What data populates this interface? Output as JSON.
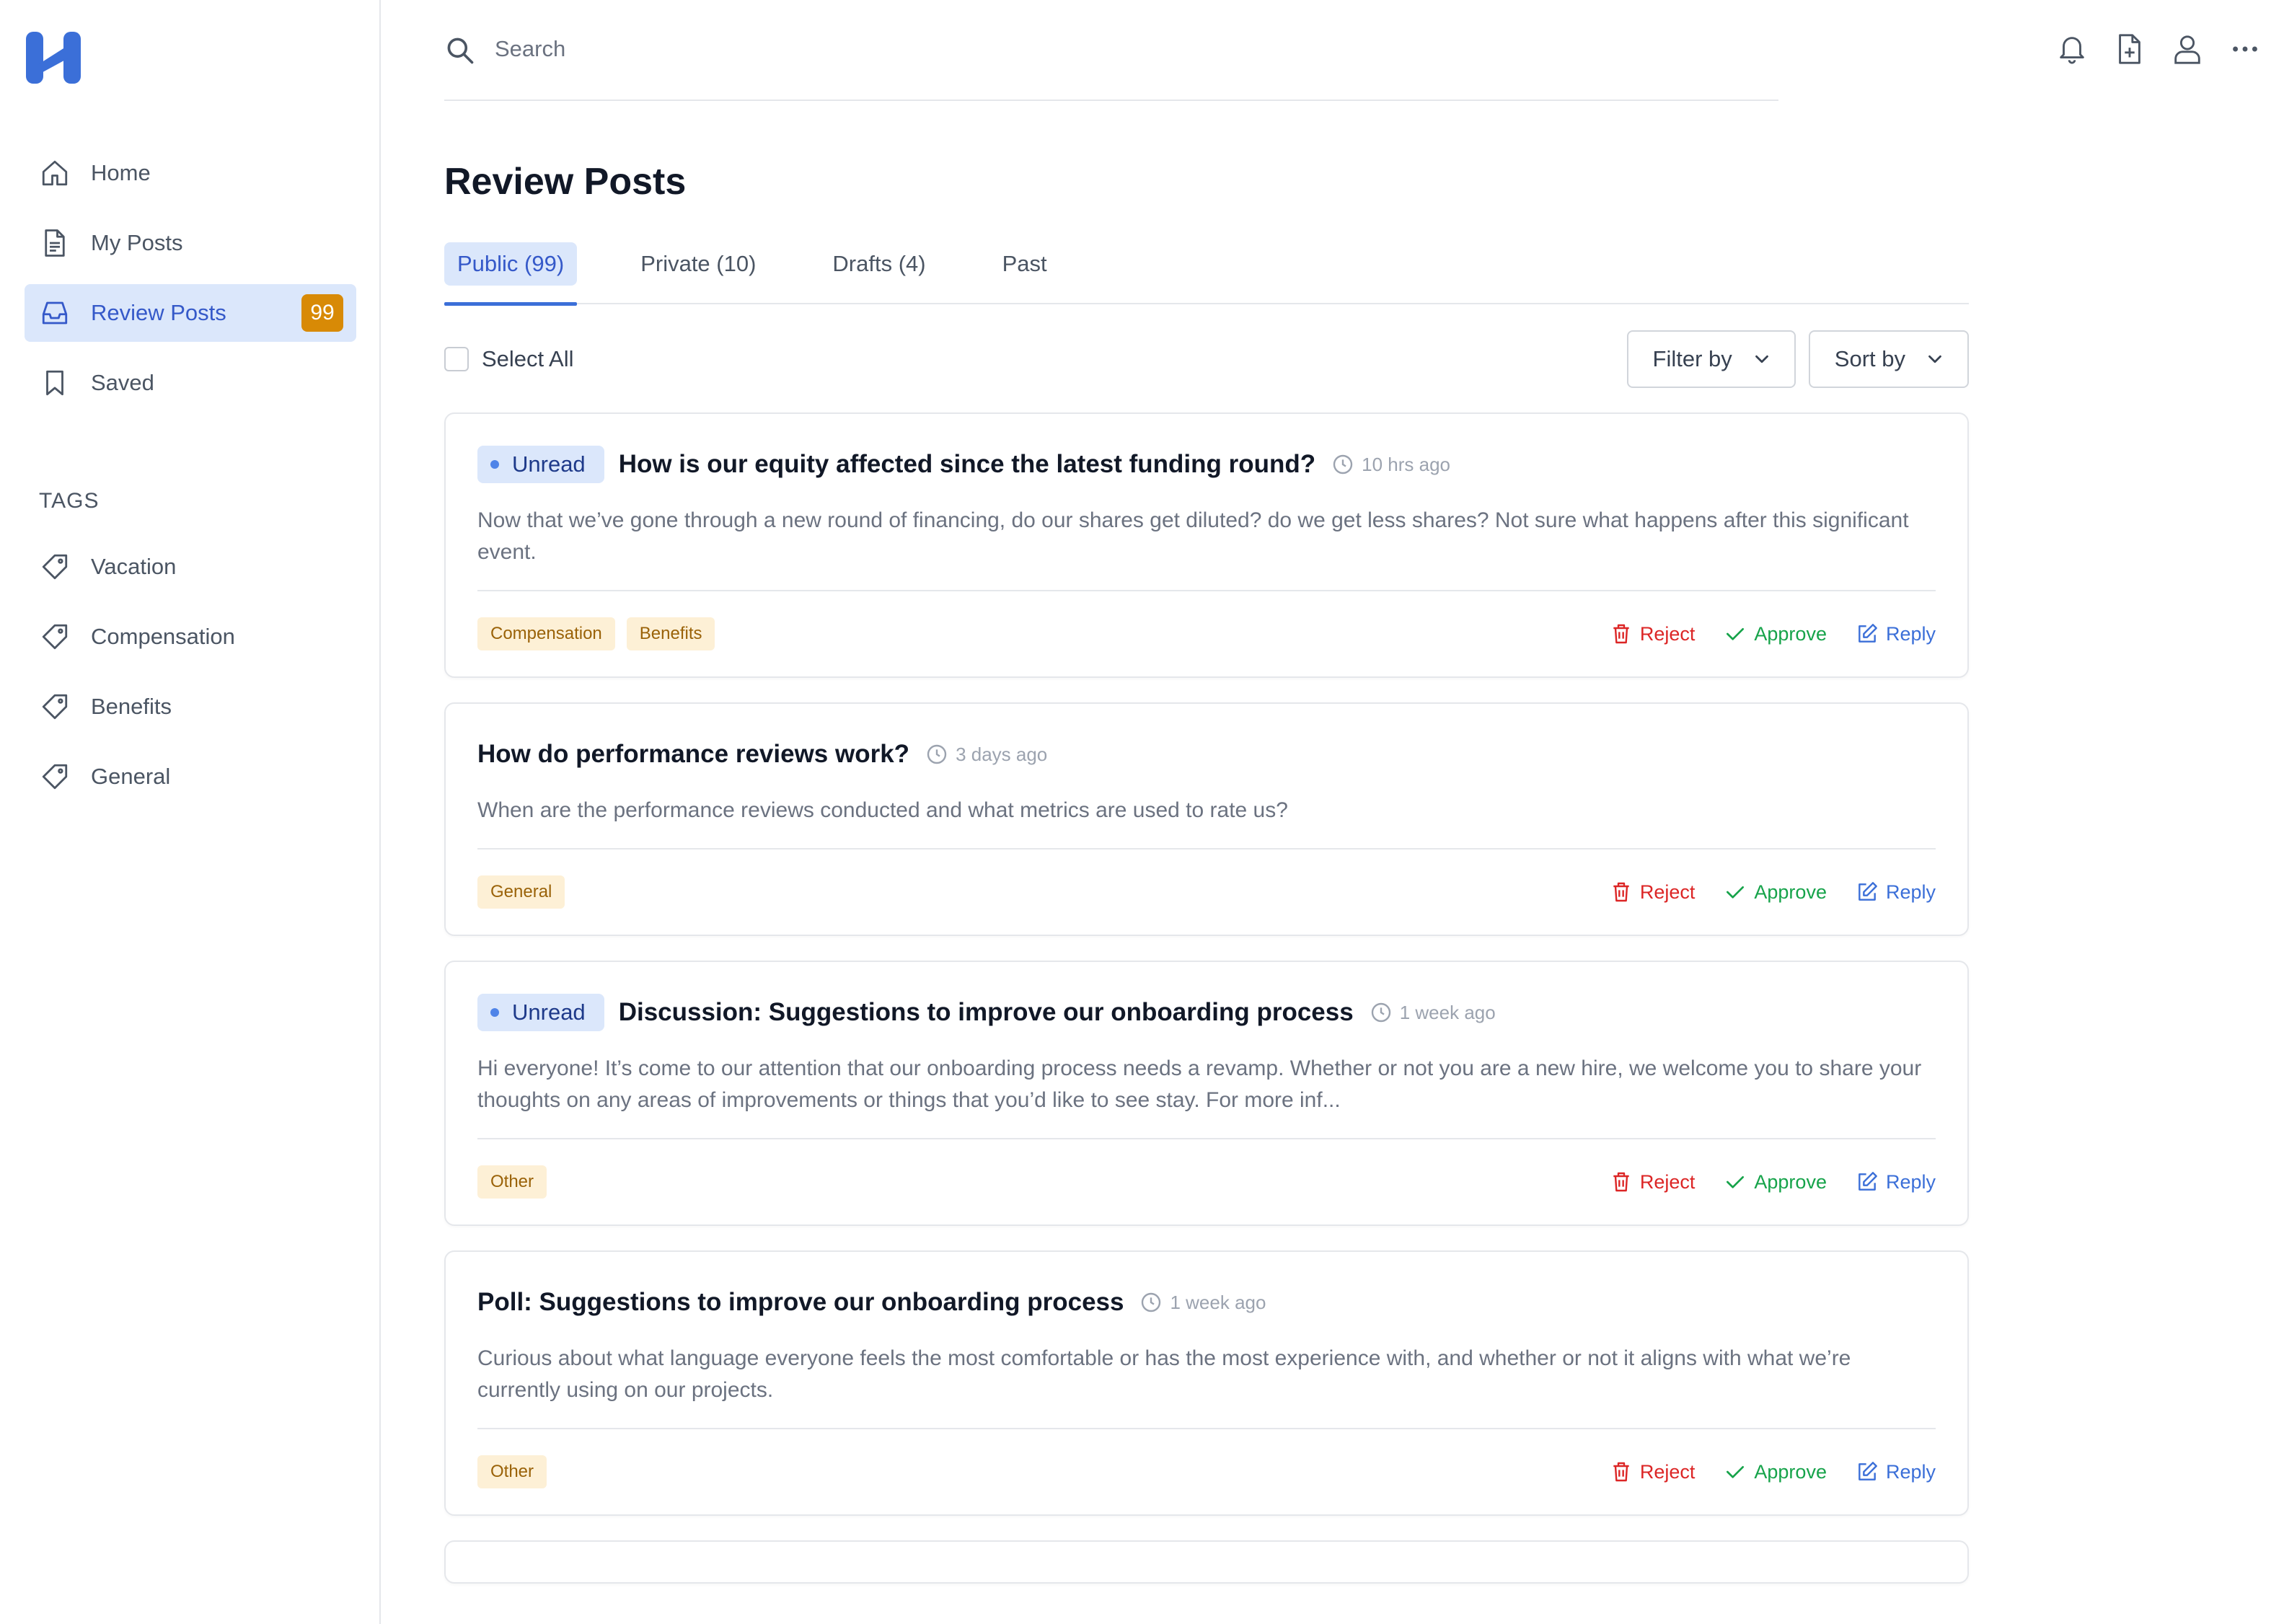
{
  "brand": {
    "logo_icon": "logo-h-icon",
    "accent": "#3b6fd8"
  },
  "search": {
    "placeholder": "Search",
    "value": ""
  },
  "top_icons": [
    "bell-icon",
    "new-document-icon",
    "user-icon",
    "more-icon"
  ],
  "sidebar": {
    "items": [
      {
        "label": "Home",
        "icon": "home-icon"
      },
      {
        "label": "My Posts",
        "icon": "document-icon"
      },
      {
        "label": "Review Posts",
        "icon": "inbox-icon",
        "badge": "99",
        "active": true
      },
      {
        "label": "Saved",
        "icon": "bookmark-icon"
      }
    ],
    "tags_heading": "TAGS",
    "tags": [
      {
        "label": "Vacation",
        "icon": "tag-icon"
      },
      {
        "label": "Compensation",
        "icon": "tag-icon"
      },
      {
        "label": "Benefits",
        "icon": "tag-icon"
      },
      {
        "label": "General",
        "icon": "tag-icon"
      }
    ]
  },
  "page": {
    "title": "Review Posts"
  },
  "tabs": [
    {
      "label": "Public (99)",
      "active": true
    },
    {
      "label": "Private (10)"
    },
    {
      "label": "Drafts (4)"
    },
    {
      "label": "Past"
    }
  ],
  "toolbar": {
    "select_all": "Select All",
    "filter": "Filter by",
    "sort": "Sort by"
  },
  "actions": {
    "reject": "Reject",
    "approve": "Approve",
    "reply": "Reply"
  },
  "posts": [
    {
      "unread": true,
      "unread_label": "Unread",
      "title": "How is our equity affected since the latest funding round?",
      "time": "10 hrs ago",
      "body": "Now that we’ve gone through a new round of financing, do our shares get diluted? do we get less shares? Not sure what happens after this significant event.",
      "tags": [
        "Compensation",
        "Benefits"
      ]
    },
    {
      "unread": false,
      "title": "How do performance reviews work?",
      "time": "3 days ago",
      "body": "When are the performance reviews conducted and what metrics are used to rate us?",
      "tags": [
        "General"
      ]
    },
    {
      "unread": true,
      "unread_label": "Unread",
      "title": "Discussion: Suggestions to improve our onboarding process",
      "time": "1 week ago",
      "body": "Hi everyone! It’s come to our attention that our onboarding process needs a revamp. Whether or not you are a new hire, we welcome you to share your thoughts on any areas of improvements or things that you’d like to see stay. For more inf...",
      "tags": [
        "Other"
      ]
    },
    {
      "unread": false,
      "title": "Poll: Suggestions to improve our onboarding process",
      "time": "1 week ago",
      "body": "Curious about what language everyone feels the most comfortable or has the most experience with, and whether or not it aligns with what we’re currently using on our projects.",
      "tags": [
        "Other"
      ]
    }
  ]
}
